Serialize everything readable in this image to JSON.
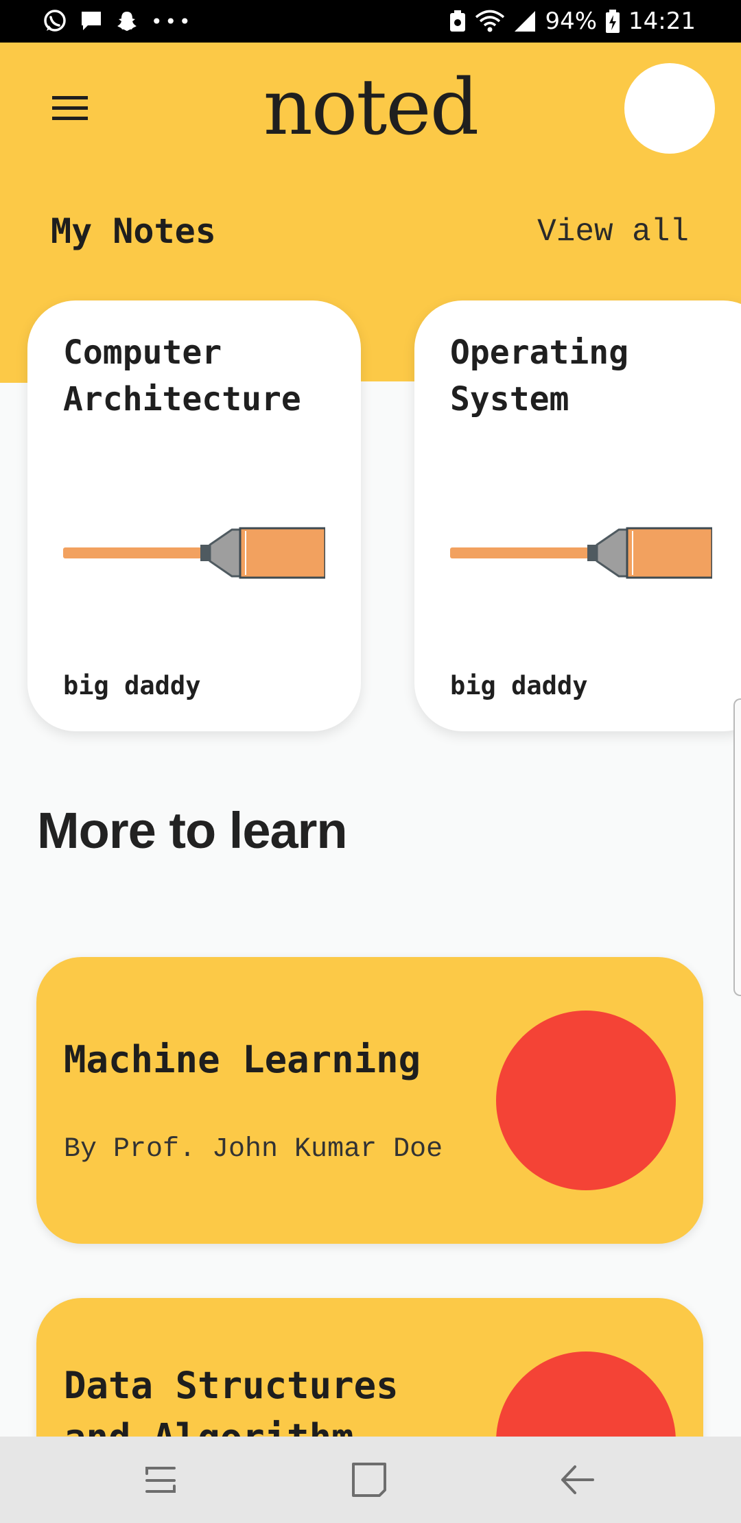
{
  "status_bar": {
    "left_icons": [
      "whatsapp-icon",
      "message-icon",
      "snapchat-icon",
      "more-dots-icon"
    ],
    "battery_percent": "94%",
    "time": "14:21"
  },
  "header": {
    "app_title": "noted",
    "menu_icon": "hamburger-menu-icon"
  },
  "my_notes": {
    "title": "My Notes",
    "view_all": "View all",
    "cards": [
      {
        "title_line1": "Computer",
        "title_line2": "Architecture",
        "author": "big daddy"
      },
      {
        "title_line1": "Operating",
        "title_line2": "System",
        "author": "big daddy"
      }
    ]
  },
  "more_to_learn": {
    "title": "More to learn",
    "courses": [
      {
        "title_line1": "Machine Learning",
        "title_line2": "",
        "subtitle": "By Prof. John Kumar Doe"
      },
      {
        "title_line1": "Data Structures",
        "title_line2": "and Algorithm",
        "subtitle": ""
      }
    ]
  },
  "colors": {
    "accent_yellow": "#fcc947",
    "dot_red": "#f44336",
    "highlighter_orange": "#f2a15f"
  },
  "nav_bar": [
    "recent-apps-icon",
    "home-icon",
    "back-icon"
  ]
}
